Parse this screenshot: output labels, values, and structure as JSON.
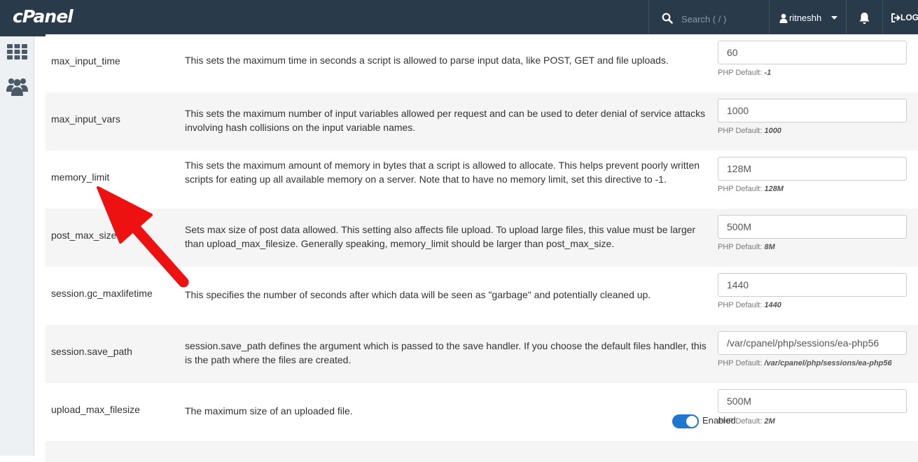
{
  "header": {
    "logo": "cPanel",
    "search_placeholder": "Search ( / )",
    "username": "ritneshh",
    "logout_label": "LOGOUT"
  },
  "colors": {
    "topbar": "#293a4a",
    "arrow": "#ee1111",
    "toggle": "#1f77d0"
  },
  "icons": {
    "search": "search-icon",
    "user": "user-icon",
    "caret": "chevron-down-icon",
    "bell": "bell-icon",
    "logout": "logout-icon",
    "sidebar_grid": "grid-icon",
    "sidebar_users": "users-icon"
  },
  "default_prefix": "PHP Default:",
  "rows": [
    {
      "name": "max_input_time",
      "description": "This sets the maximum time in seconds a script is allowed to parse input data, like POST, GET and file uploads.",
      "value": "60",
      "php_default": "-1"
    },
    {
      "name": "max_input_vars",
      "description": "This sets the maximum number of input variables allowed per request and can be used to deter denial of service attacks involving hash collisions on the input variable names.",
      "value": "1000",
      "php_default": "1000"
    },
    {
      "name": "memory_limit",
      "description": "This sets the maximum amount of memory in bytes that a script is allowed to allocate. This helps prevent poorly written scripts for eating up all available memory on a server. Note that to have no memory limit, set this directive to -1.",
      "value": "128M",
      "php_default": "128M"
    },
    {
      "name": "post_max_size",
      "description": "Sets max size of post data allowed. This setting also affects file upload. To upload large files, this value must be larger than upload_max_filesize. Generally speaking, memory_limit should be larger than post_max_size.",
      "value": "500M",
      "php_default": "8M"
    },
    {
      "name": "session.gc_maxlifetime",
      "description": "This specifies the number of seconds after which data will be seen as \"garbage\" and potentially cleaned up.",
      "value": "1440",
      "php_default": "1440"
    },
    {
      "name": "session.save_path",
      "description": "session.save_path defines the argument which is passed to the save handler. If you choose the default files handler, this is the path where the files are created.",
      "value": "/var/cpanel/php/sessions/ea-php56",
      "php_default": "/var/cpanel/php/sessions/ea-php56"
    },
    {
      "name": "upload_max_filesize",
      "description": "The maximum size of an uploaded file.",
      "value": "500M",
      "php_default": "2M"
    }
  ],
  "last_row": {
    "toggle_label": "Enabled"
  }
}
